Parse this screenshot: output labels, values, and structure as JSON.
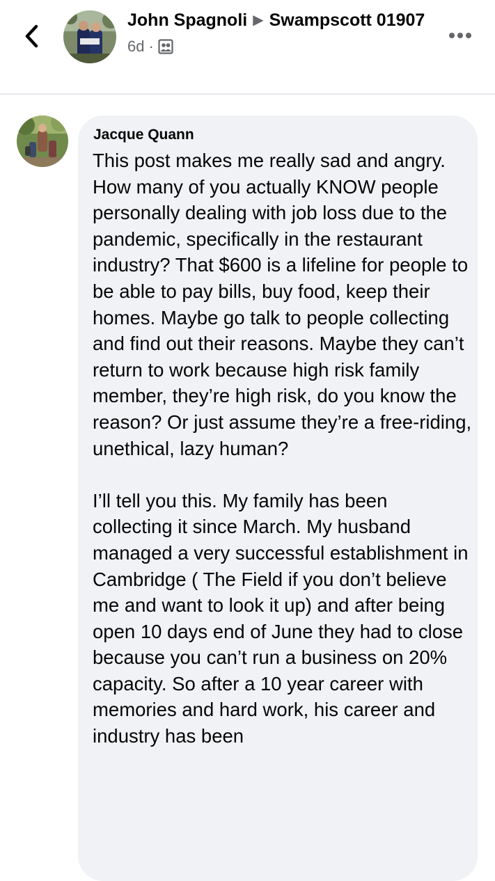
{
  "header": {
    "poster_name": "John Spagnoli",
    "group_name": "Swampscott 01907",
    "time": "6d",
    "separator": "·",
    "audience_icon": "group-audience-icon",
    "back_icon": "chevron-left-icon",
    "more_icon": "more-horizontal-icon"
  },
  "comment": {
    "author": "Jacque Quann",
    "paragraph_1": "This post makes me really sad and angry. How many of you actually KNOW people personally dealing with job loss due to the pandemic, specifically in the restaurant industry? That $600 is a lifeline for people to be able to pay bills, buy food, keep their homes. Maybe go talk to people collecting and find out their reasons. Maybe they can’t return to work because high risk family member, they’re high risk, do you know the reason? Or just assume they’re a free-riding, unethical, lazy human?",
    "paragraph_2": "I’ll tell you this. My family has been collecting it since March. My husband managed a very successful establishment in Cambridge ( The Field if you don’t believe me and want to look it up) and after being open 10 days end of June they had to close because you can’t run a business on 20% capacity. So after a 10 year career with memories and hard work, his career and industry has been"
  },
  "colors": {
    "bubble": "#f0f2f5",
    "secondary_text": "#65676b",
    "primary_text": "#050505",
    "divider": "#e4e6eb"
  }
}
